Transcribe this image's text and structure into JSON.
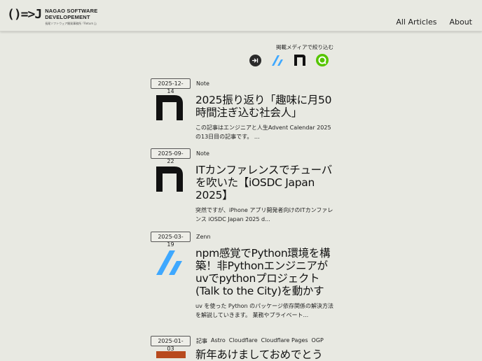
{
  "header": {
    "logo_mark": "()=>J",
    "logo_line1": "NAGAO SOFTWARE",
    "logo_line2": "DEVELOPEMENT",
    "logo_sub": "長尾ソフトウェア開発事務所「Return J」",
    "nav": [
      "All Articles",
      "About"
    ]
  },
  "filter": {
    "label": "掲載メディアで絞り込む",
    "icons": [
      "external-icon",
      "zenn-icon",
      "note-icon",
      "qiita-icon"
    ]
  },
  "articles": [
    {
      "date": "2025-12-14",
      "tags": [
        "Note"
      ],
      "thumb": "note-logo",
      "title": "2025振り返り「趣味に月50時間注ぎ込む社会人」",
      "excerpt": "この記事はエンジニアと人生Advent Calendar 2025の13日目の記事です。 ..."
    },
    {
      "date": "2025-09-22",
      "tags": [
        "Note"
      ],
      "thumb": "note-logo",
      "title": "ITカンファレンスでチューバを吹いた【iOSDC Japan 2025】",
      "excerpt": "突然ですが、iPhone アプリ開発者向けのITカンファレンス iOSDC Japan 2025 d..."
    },
    {
      "date": "2025-03-19",
      "tags": [
        "Zenn"
      ],
      "thumb": "zenn-logo",
      "title": "npm感覚でPython環境を構築！非Pythonエンジニアがuvでpythonプロジェクト(Talk to the City)を動かす",
      "excerpt": "uv を使った Python のパッケージ依存関係の解決方法を解説していきます。 業務やプライベート..."
    },
    {
      "date": "2025-01-03",
      "tags": [
        "記事",
        "Astro",
        "Cloudflare",
        "Cloudflare Pages",
        "OGP"
      ],
      "thumb": "photo",
      "title": "新年あけましておめでとう",
      "excerpt": ""
    }
  ]
}
